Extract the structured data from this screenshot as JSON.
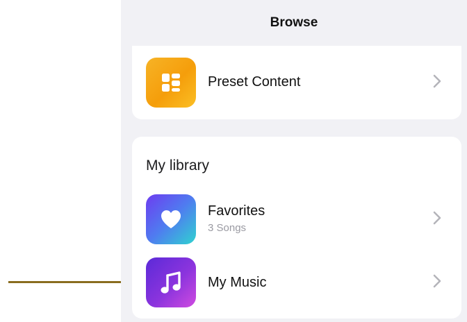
{
  "nav": {
    "title": "Browse"
  },
  "preset": {
    "label": "Preset Content",
    "icon": "grid-icon"
  },
  "library": {
    "section_title": "My library",
    "items": [
      {
        "label": "Favorites",
        "subtitle": "3 Songs",
        "icon": "heart-icon"
      },
      {
        "label": "My Music",
        "subtitle": "",
        "icon": "music-note-icon"
      }
    ]
  },
  "colors": {
    "preset_tile": "#f59e0b",
    "favorites_tile_start": "#6d3cf0",
    "favorites_tile_end": "#2fd3d0",
    "music_tile_start": "#5b2ad8",
    "music_tile_end": "#d04be0",
    "panel_background": "#f1f1f5",
    "pointer_line": "#8a6d1f"
  }
}
